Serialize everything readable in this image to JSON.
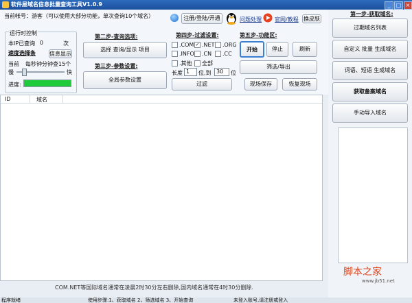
{
  "title": "软件屋域名信息批量查询工具V1.0.9",
  "account_line": "当前帐号：游客（可以使用大部分功能，单次查询10个域名）",
  "header_buttons": {
    "register": "注册/登陆/开通",
    "problem": "问题处理",
    "website": "官网/教程",
    "skin": "换皮肤"
  },
  "runtime": {
    "heading": "运行时控制",
    "ip_label": "本IP已查询",
    "ip_count": "0",
    "ip_unit": "次",
    "speed_label": "速度选择条",
    "info_button": "信息显示",
    "current_label": "当前",
    "per_minute": "每秒钟分钟查15个",
    "slow": "慢",
    "fast": "快",
    "progress_label": "进度:",
    "progress_value": 1.0
  },
  "step2": {
    "heading": "第二步-查询选项:",
    "button": "选择 查询/显示 项目"
  },
  "step3": {
    "heading": "第三步-参数设置:",
    "button": "全局参数设置"
  },
  "step4": {
    "heading": "第四步-过滤设置:",
    "checkboxes": [
      {
        "label": ".COM",
        "checked": false
      },
      {
        "label": ".NET",
        "checked": true
      },
      {
        "label": ".ORG",
        "checked": false
      },
      {
        "label": ".INFO",
        "checked": false
      },
      {
        "label": ".CN",
        "checked": false
      },
      {
        "label": ".CC",
        "checked": false
      },
      {
        "label": ".其他",
        "checked": false
      },
      {
        "label": "全部",
        "checked": false
      }
    ],
    "length_label": "长度",
    "length_from": "1",
    "length_to_label": "位,到",
    "length_to": "30",
    "length_unit": "位",
    "filter_button": "过滤"
  },
  "step5": {
    "heading": "第五步-功能区:",
    "start": "开始",
    "stop": "停止",
    "refresh": "刷新",
    "export": "筛选/导出",
    "save": "现场保存",
    "restore": "恢复现场"
  },
  "table": {
    "columns": [
      "ID",
      "域名"
    ]
  },
  "notice": "COM.NET等国际域名通常在凌晨2时30分左右删除,国内域名通常在4时30分删除.",
  "right_panel": {
    "heading": "第一步-获取域名:",
    "buttons": [
      "过期域名列表",
      "自定义 批量 生成域名",
      "词语、短语 生成域名",
      "获取备案域名",
      "手动导入域名"
    ]
  },
  "watermark": {
    "title": "脚本之家",
    "url": "www.jb51.net"
  },
  "status_bar": {
    "left": "程序就绪",
    "stats": "使用步骤:1、获取域名 2、筛选域名 3、开始查询",
    "right": "未登入账号,请注册或登入"
  },
  "colors": {
    "title_bg": "#1c4f9c",
    "progress": "#1fca3b",
    "panel_bg": "#f3f6fa"
  }
}
